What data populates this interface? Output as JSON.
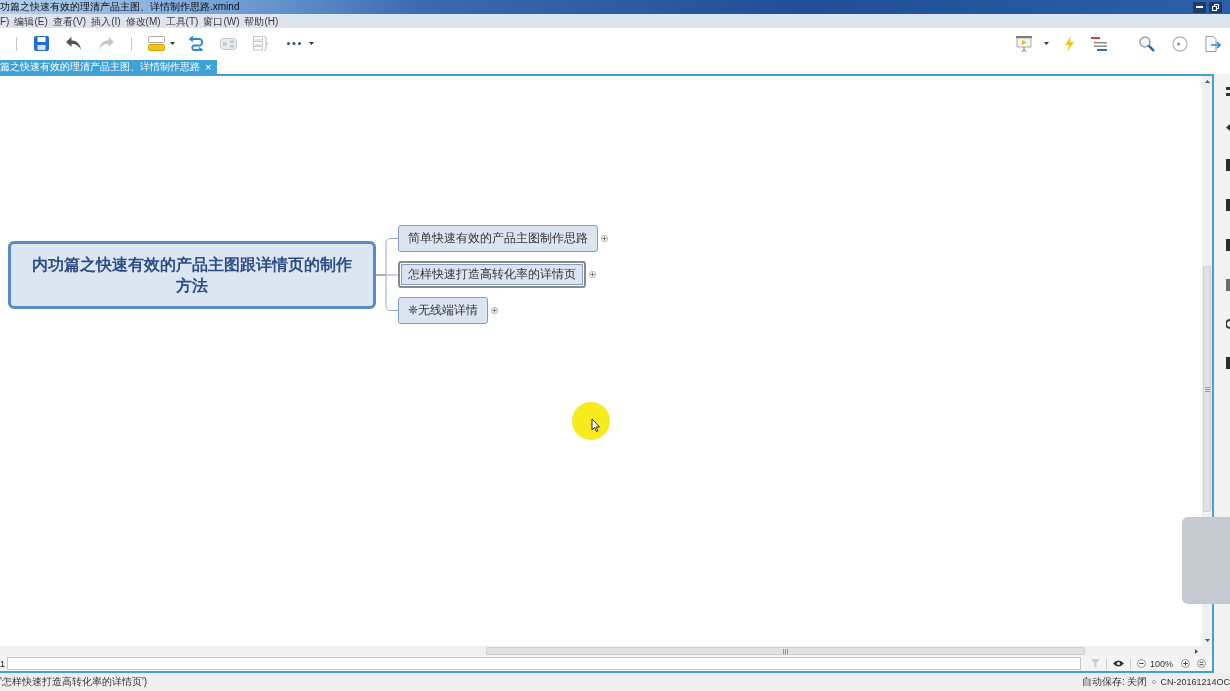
{
  "window": {
    "title": "功篇之快速有效的理清产品主图、详情制作思路.xmind"
  },
  "menu": [
    "F)",
    "编辑(E)",
    "查看(V)",
    "插入(I)",
    "修改(M)",
    "工具(T)",
    "窗口(W)",
    "帮助(H)"
  ],
  "toolbar": {
    "undo": {
      "disabled": false
    },
    "redo": {
      "disabled": true
    },
    "frame": {
      "disabled": true
    },
    "summary": {
      "disabled": true
    }
  },
  "tabs": [
    {
      "label": "篇之快速有效的理清产品主图、详情制作思路",
      "selected": true,
      "close": "×"
    }
  ],
  "mindmap": {
    "central_topic": "内功篇之快速有效的产品主图跟详情页的制作方法",
    "subtopics": [
      {
        "label": "简单快速有效的产品主图制作思路",
        "selected": false,
        "collapsed": true
      },
      {
        "label": "怎样快速打造高转化率的详情页",
        "selected": true,
        "collapsed": true
      },
      {
        "label": "❈无线端详情",
        "selected": false,
        "collapsed": true
      }
    ]
  },
  "input_bar": {
    "label": "1"
  },
  "zoom": {
    "value": "100%"
  },
  "status_bar": {
    "message": "'怎样快速打造高转化率的详情页')",
    "autosave": "自动保存: 关闭",
    "computer": "CN-20161214OC"
  }
}
